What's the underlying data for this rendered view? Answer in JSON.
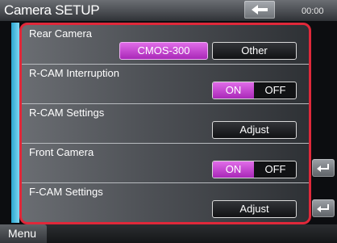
{
  "header": {
    "title": "Camera SETUP",
    "clock": "00:00"
  },
  "rows": [
    {
      "label": "Rear Camera",
      "buttons": [
        "CMOS-300",
        "Other"
      ],
      "selected": "CMOS-300"
    },
    {
      "label": "R-CAM Interruption",
      "on_label": "ON",
      "off_label": "OFF",
      "value": "ON"
    },
    {
      "label": "R-CAM Settings",
      "button": "Adjust"
    },
    {
      "label": "Front Camera",
      "on_label": "ON",
      "off_label": "OFF",
      "value": "ON"
    },
    {
      "label": "F-CAM Settings",
      "button": "Adjust"
    }
  ],
  "footer": {
    "menu_label": "Menu"
  },
  "colors": {
    "highlight_border": "#e0283a",
    "selected_fill": "#c34ad0",
    "scroll_strip": "#2aa6d0"
  },
  "icons": [
    "back-arrow-icon",
    "return-icon"
  ]
}
